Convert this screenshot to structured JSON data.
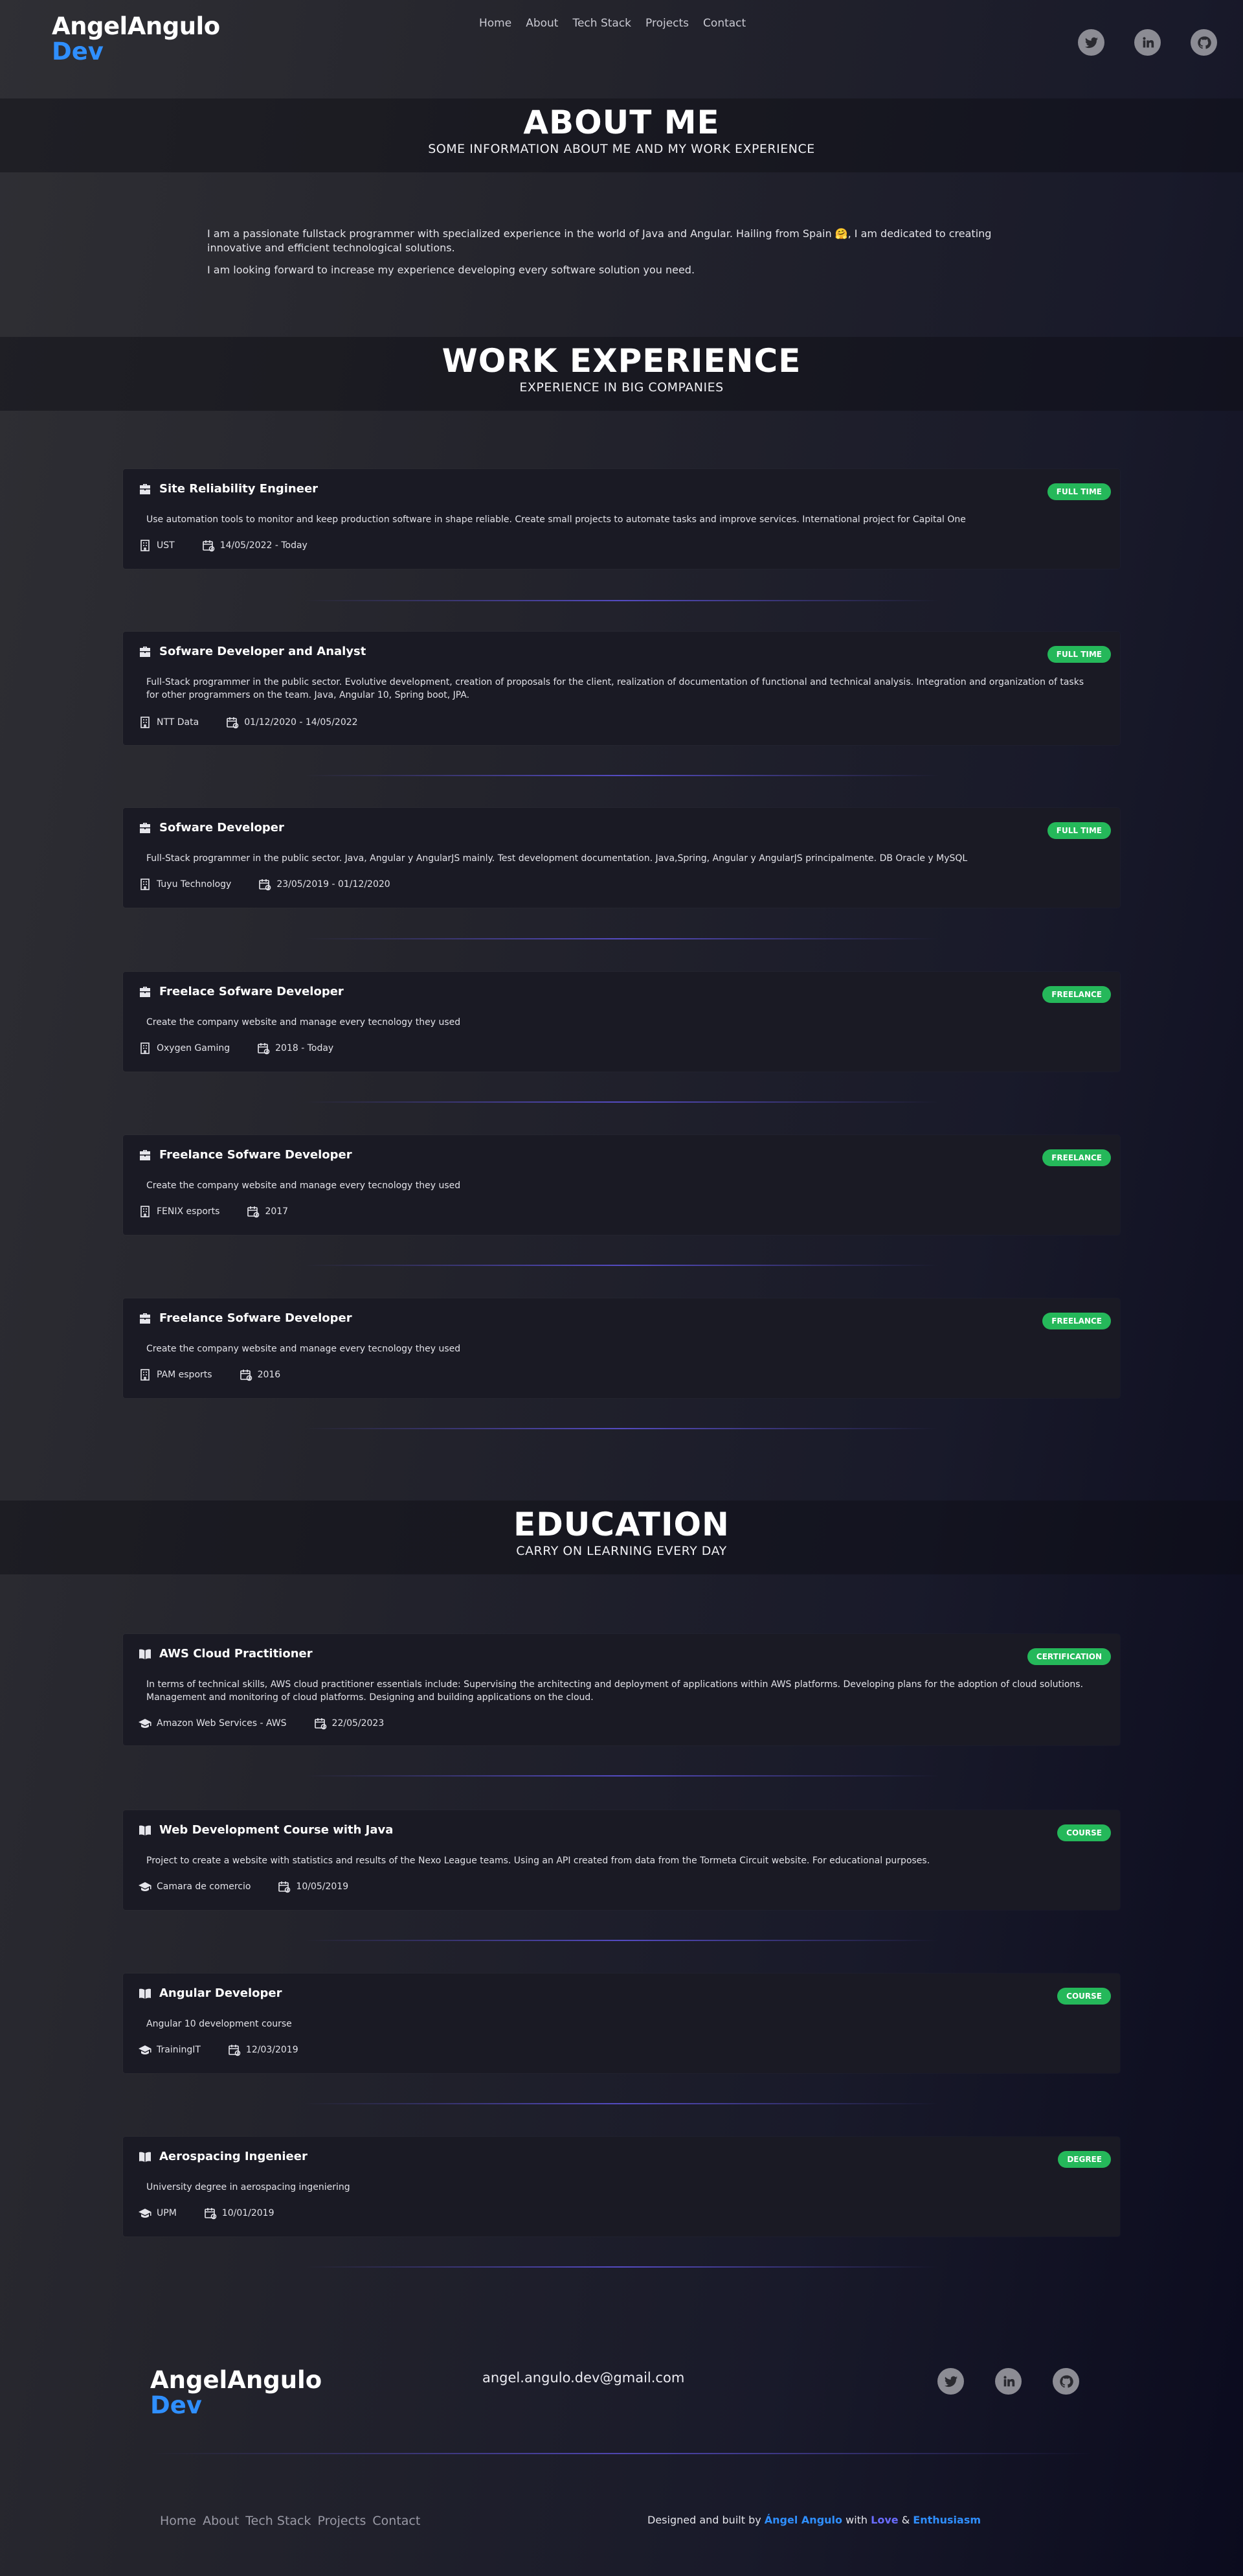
{
  "header": {
    "logo_line1": "AngelAngulo",
    "logo_line2": "Dev",
    "nav": [
      "Home",
      "About",
      "Tech Stack",
      "Projects",
      "Contact"
    ]
  },
  "about": {
    "title": "ABOUT ME",
    "subtitle": "SOME INFORMATION ABOUT ME AND MY WORK EXPERIENCE",
    "paragraph1": "I am a passionate fullstack programmer with specialized experience in the world of Java and Angular. Hailing from Spain 🤗, I am dedicated to creating innovative and efficient technological solutions.",
    "paragraph2": "I am looking forward to increase my experience developing every software solution you need."
  },
  "work": {
    "title": "WORK EXPERIENCE",
    "subtitle": "EXPERIENCE IN BIG COMPANIES",
    "items": [
      {
        "role": "Site Reliability Engineer",
        "badge": "FULL TIME",
        "desc": "Use automation tools to monitor and keep production software in shape reliable. Create small projects to automate tasks and improve services. International project for Capital One",
        "company": "UST",
        "dates": "14/05/2022 - Today"
      },
      {
        "role": "Sofware Developer and Analyst",
        "badge": "FULL TIME",
        "desc": "Full-Stack programmer in the public sector. Evolutive development, creation of proposals for the client, realization of documentation of functional and technical analysis. Integration and organization of tasks for other programmers on the team. Java, Angular 10, Spring boot, JPA.",
        "company": "NTT Data",
        "dates": "01/12/2020 - 14/05/2022"
      },
      {
        "role": "Sofware Developer",
        "badge": "FULL TIME",
        "desc": "Full-Stack programmer in the public sector. Java, Angular y AngularJS mainly. Test development documentation. Java,Spring, Angular y AngularJS principalmente. DB Oracle y MySQL",
        "company": "Tuyu Technology",
        "dates": "23/05/2019 - 01/12/2020"
      },
      {
        "role": "Freelace Sofware Developer",
        "badge": "FREELANCE",
        "desc": "Create the company website and manage every tecnology they used",
        "company": "Oxygen Gaming",
        "dates": "2018 - Today"
      },
      {
        "role": "Freelance Sofware Developer",
        "badge": "FREELANCE",
        "desc": "Create the company website and manage every tecnology they used",
        "company": "FENIX esports",
        "dates": "2017"
      },
      {
        "role": "Freelance Sofware Developer",
        "badge": "FREELANCE",
        "desc": "Create the company website and manage every tecnology they used",
        "company": "PAM esports",
        "dates": "2016"
      }
    ]
  },
  "education": {
    "title": "EDUCATION",
    "subtitle": "CARRY ON LEARNING EVERY DAY",
    "items": [
      {
        "name": "AWS Cloud Practitioner",
        "badge": "CERTIFICATION",
        "desc": "In terms of technical skills, AWS cloud practitioner essentials include: Supervising the architecting and deployment of applications within AWS platforms. Developing plans for the adoption of cloud solutions. Management and monitoring of cloud platforms. Designing and building applications on the cloud.",
        "school": "Amazon Web Services - AWS",
        "dates": "22/05/2023"
      },
      {
        "name": "Web Development Course with Java",
        "badge": "COURSE",
        "desc": "Project to create a website with statistics and results of the Nexo League teams. Using an API created from data from the Tormeta Circuit website. For educational purposes.",
        "school": "Camara de comercio",
        "dates": "10/05/2019"
      },
      {
        "name": "Angular Developer",
        "badge": "COURSE",
        "desc": "Angular 10 development course",
        "school": "TrainingIT",
        "dates": "12/03/2019"
      },
      {
        "name": "Aerospacing Ingenieer",
        "badge": "DEGREE",
        "desc": "University degree in aerospacing ingeniering",
        "school": "UPM",
        "dates": "10/01/2019"
      }
    ]
  },
  "footer": {
    "logo_line1": "AngelAngulo",
    "logo_line2": "Dev",
    "email": "angel.angulo.dev@gmail.com",
    "nav": [
      "Home",
      "About",
      "Tech Stack",
      "Projects",
      "Contact"
    ],
    "credit_prefix": "Designed and built by ",
    "credit_name": "Ángel Angulo",
    "credit_with": " with ",
    "credit_love": "Love",
    "credit_amp": " & ",
    "credit_enth": "Enthusiasm"
  },
  "icons": {
    "social": [
      "twitter-icon",
      "linkedin-icon",
      "github-icon"
    ],
    "work_title": "briefcase-icon",
    "education_title": "book-icon",
    "company": "building-icon",
    "school": "graduation-cap-icon",
    "date": "calendar-icon"
  },
  "colors": {
    "accent": "#2f8fff",
    "badge": "#25b85a",
    "card": "#1a1a24",
    "separator": "#5a50d2",
    "love": "#6a6cff"
  }
}
